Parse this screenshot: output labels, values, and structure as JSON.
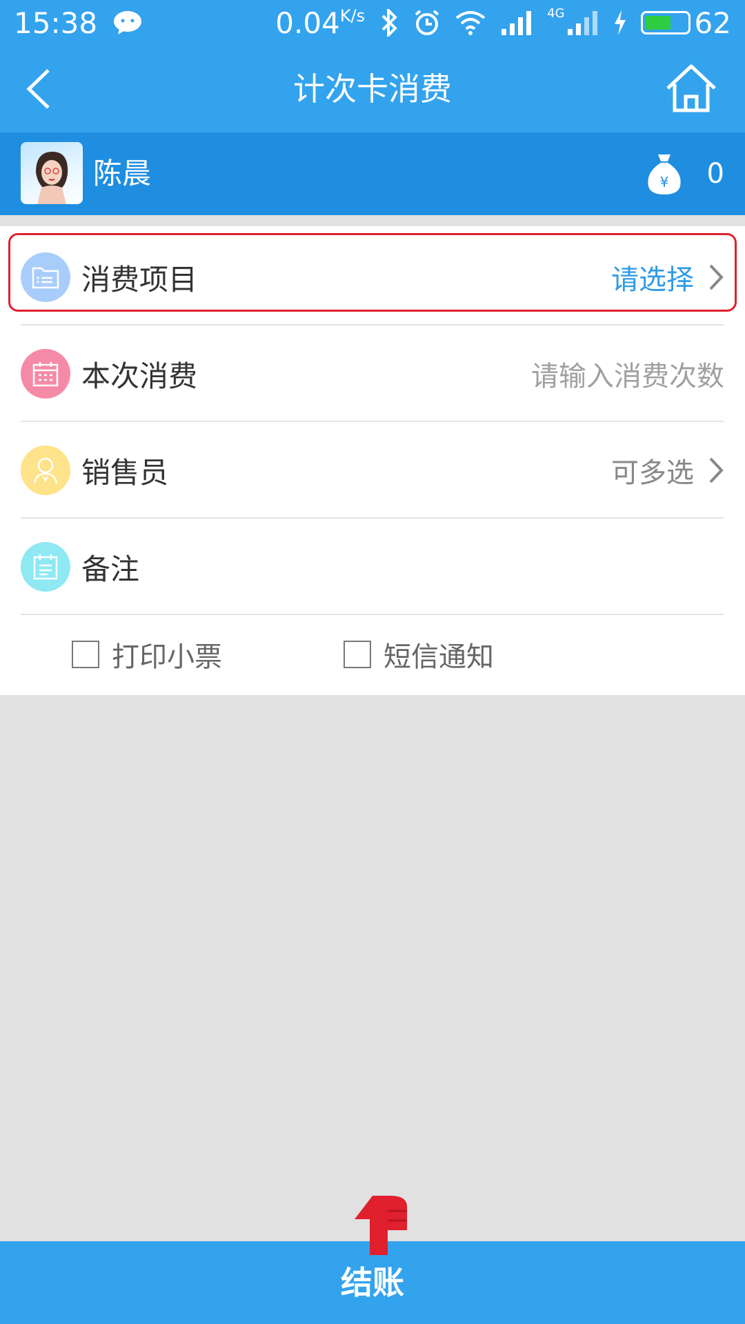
{
  "status_bar": {
    "time": "15:38",
    "speed_value": "0.04",
    "speed_unit": "K/s",
    "network": "4G",
    "battery": "62"
  },
  "nav": {
    "title": "计次卡消费"
  },
  "member": {
    "name": "陈晨",
    "balance": "0"
  },
  "form": {
    "item": {
      "label": "消费项目",
      "value": "请选择"
    },
    "count": {
      "label": "本次消费",
      "placeholder": "请输入消费次数"
    },
    "seller": {
      "label": "销售员",
      "value": "可多选"
    },
    "note": {
      "label": "备注"
    },
    "print_receipt": "打印小票",
    "sms_notify": "短信通知"
  },
  "footer": {
    "checkout_label": "结账"
  },
  "colors": {
    "primary": "#33a3ee",
    "member_bar": "#1f8ee0",
    "highlight": "#e0202d",
    "link": "#2f9be6",
    "icon_blue": "#a9cdfb",
    "icon_pink": "#f58aa6",
    "icon_yellow": "#ffe38a",
    "icon_cyan": "#8ee9f3"
  }
}
